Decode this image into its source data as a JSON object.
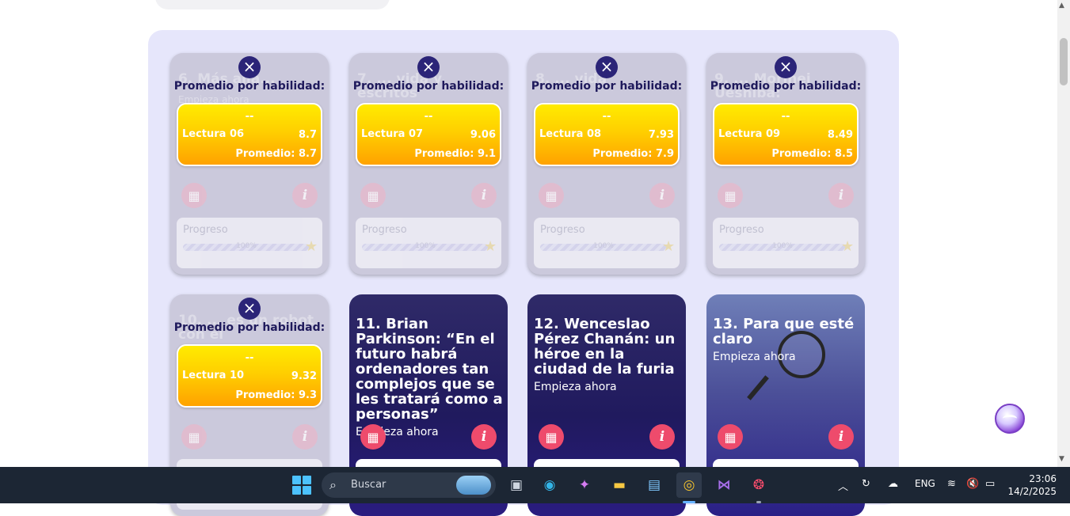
{
  "done_cards": [
    {
      "ghost_title": "6. Más allá...",
      "ghost_sub": "Empieza ahora",
      "avg_title": "Promedio por habilidad:",
      "dash": "--",
      "lectura": "Lectura 06",
      "score": "8.7",
      "promedio": "Promedio: 8.7",
      "progress_label": "Progreso",
      "progress_text": "100%",
      "progress_value": 1.0
    },
    {
      "ghost_title": "7. ... vida y escritos",
      "ghost_sub": "",
      "avg_title": "Promedio por habilidad:",
      "dash": "--",
      "lectura": "Lectura 07",
      "score": "9.06",
      "promedio": "Promedio: 9.1",
      "progress_label": "Progreso",
      "progress_text": "100%",
      "progress_value": 1.0
    },
    {
      "ghost_title": "8. ... vida",
      "ghost_sub": "",
      "avg_title": "Promedio por habilidad:",
      "dash": "--",
      "lectura": "Lectura 08",
      "score": "7.93",
      "promedio": "Promedio: 7.9",
      "progress_label": "Progreso",
      "progress_text": "100%",
      "progress_value": 1.0
    },
    {
      "ghost_title": "9. ... Morihei Ueshiba:",
      "ghost_sub": "",
      "avg_title": "Promedio por habilidad:",
      "dash": "--",
      "lectura": "Lectura 09",
      "score": "8.49",
      "promedio": "Promedio: 8.5",
      "progress_label": "Progreso",
      "progress_text": "100%",
      "progress_value": 1.0
    },
    {
      "ghost_title": "10. ... es un robot con el",
      "ghost_sub": "",
      "avg_title": "Promedio por habilidad:",
      "dash": "--",
      "lectura": "Lectura 10",
      "score": "9.32",
      "promedio": "Promedio: 9.3",
      "progress_label": "",
      "progress_text": "",
      "progress_value": 1.0
    }
  ],
  "active_cards": [
    {
      "title": "11. Brian Parkinson: “En el futuro habrá ordenadores tan complejos que se les tratará como a personas”",
      "subtitle": "Empieza ahora"
    },
    {
      "title": "12. Wenceslao Pérez Chanán: un héroe en la ciudad de la furia",
      "subtitle": "Empieza ahora"
    },
    {
      "title": "13. Para que esté claro",
      "subtitle": "Empieza ahora"
    }
  ],
  "icons": {
    "close": "×",
    "calendar": "▦",
    "info": "i",
    "star": "★"
  },
  "taskbar": {
    "search_placeholder": "Buscar",
    "apps": [
      "file-explorer-icon",
      "edge-icon",
      "copilot-icon",
      "folder-icon",
      "store-icon",
      "chrome-icon",
      "visual-studio-icon",
      "creative-cloud-icon"
    ],
    "language": "ENG",
    "time": "23:06",
    "date": "14/2/2025"
  }
}
